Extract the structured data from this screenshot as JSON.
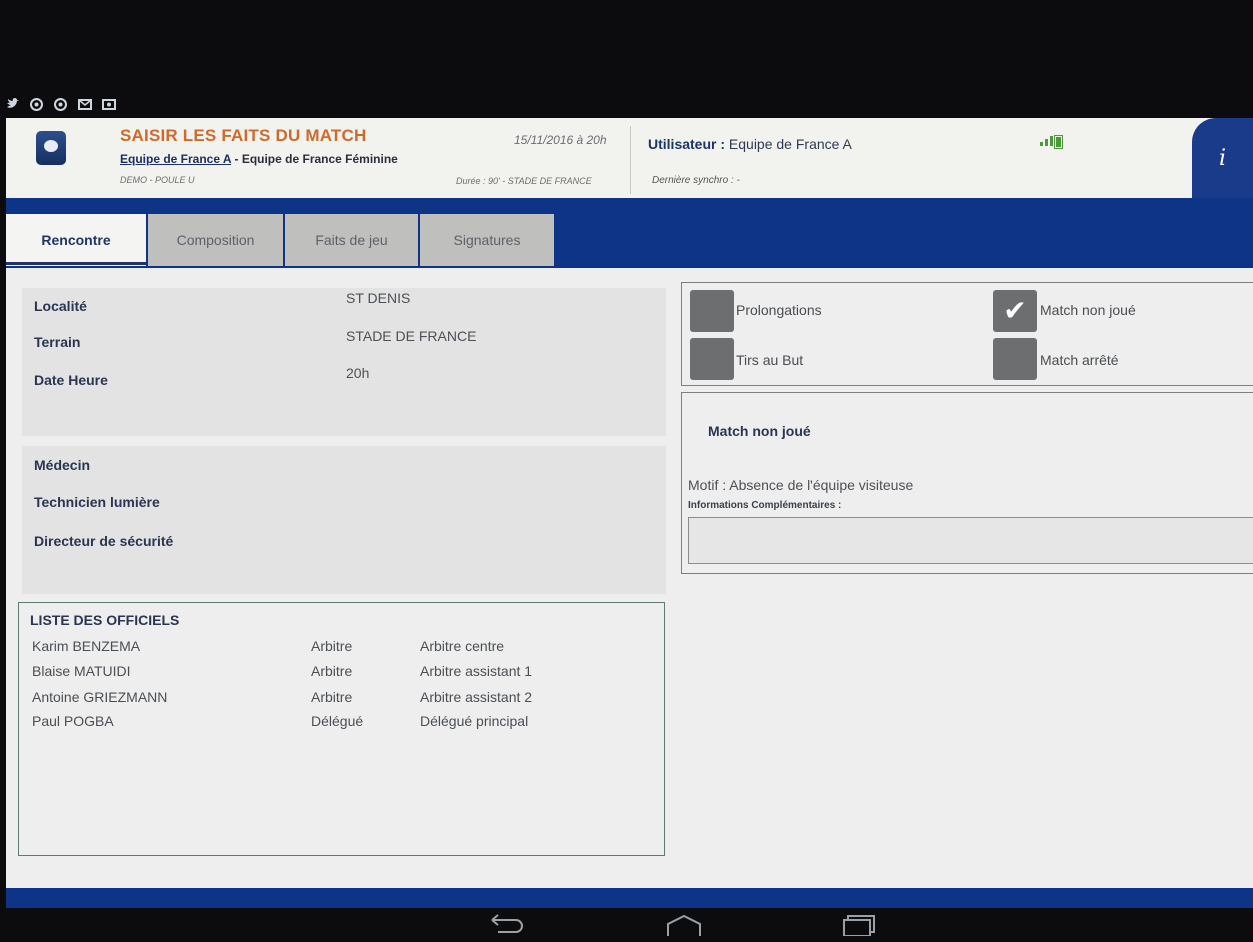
{
  "header": {
    "title": "SAISIR LES FAITS DU MATCH",
    "home_team": "Equipe de France A",
    "separator": " - ",
    "away_team": "Equipe de France Féminine",
    "competition": "DEMO - POULE U",
    "datetime": "15/11/2016 à 20h",
    "duration_venue": "Durée : 90' - STADE DE FRANCE",
    "user_label": "Utilisateur :",
    "user_value": "Equipe de France A",
    "last_sync": "Dernière synchro : -",
    "info_icon": "i"
  },
  "tabs": [
    {
      "label": "Rencontre",
      "active": true
    },
    {
      "label": "Composition",
      "active": false
    },
    {
      "label": "Faits de jeu",
      "active": false
    },
    {
      "label": "Signatures",
      "active": false
    }
  ],
  "match_info": {
    "localite_label": "Localité",
    "localite_value": "ST DENIS",
    "terrain_label": "Terrain",
    "terrain_value": "STADE DE FRANCE",
    "date_label": "Date Heure",
    "date_value": "20h"
  },
  "staff": {
    "medecin_label": "Médecin",
    "technicien_label": "Technicien lumière",
    "directeur_label": "Directeur de sécurité"
  },
  "options": {
    "prolongations": {
      "label": "Prolongations",
      "checked": false
    },
    "tirs_au_but": {
      "label": "Tirs au But",
      "checked": false
    },
    "match_non_joue": {
      "label": "Match non joué",
      "checked": true
    },
    "match_arrete": {
      "label": "Match arrêté",
      "checked": false
    }
  },
  "non_joue": {
    "title": "Match non joué",
    "motif": "Motif : Absence de l'équipe visiteuse",
    "info_label": "Informations Complémentaires :",
    "info_value": ""
  },
  "officials": {
    "title": "LISTE DES OFFICIELS",
    "rows": [
      {
        "name": "Karim BENZEMA",
        "role": "Arbitre",
        "position": "Arbitre centre"
      },
      {
        "name": "Blaise MATUIDI",
        "role": "Arbitre",
        "position": "Arbitre assistant 1"
      },
      {
        "name": "Antoine GRIEZMANN",
        "role": "Arbitre",
        "position": "Arbitre assistant 2"
      },
      {
        "name": "Paul POGBA",
        "role": "Délégué",
        "position": "Délégué principal"
      }
    ]
  },
  "colors": {
    "brand_blue": "#0e3488",
    "title_orange": "#d06a2b",
    "label_navy": "#2a3552"
  },
  "icons": [
    "twitter-icon",
    "chrome-icon",
    "chrome-icon",
    "mail-icon",
    "image-icon",
    "signal-icon",
    "battery-icon",
    "info-icon",
    "back-icon",
    "home-icon",
    "recents-icon",
    "checkmark-icon"
  ]
}
